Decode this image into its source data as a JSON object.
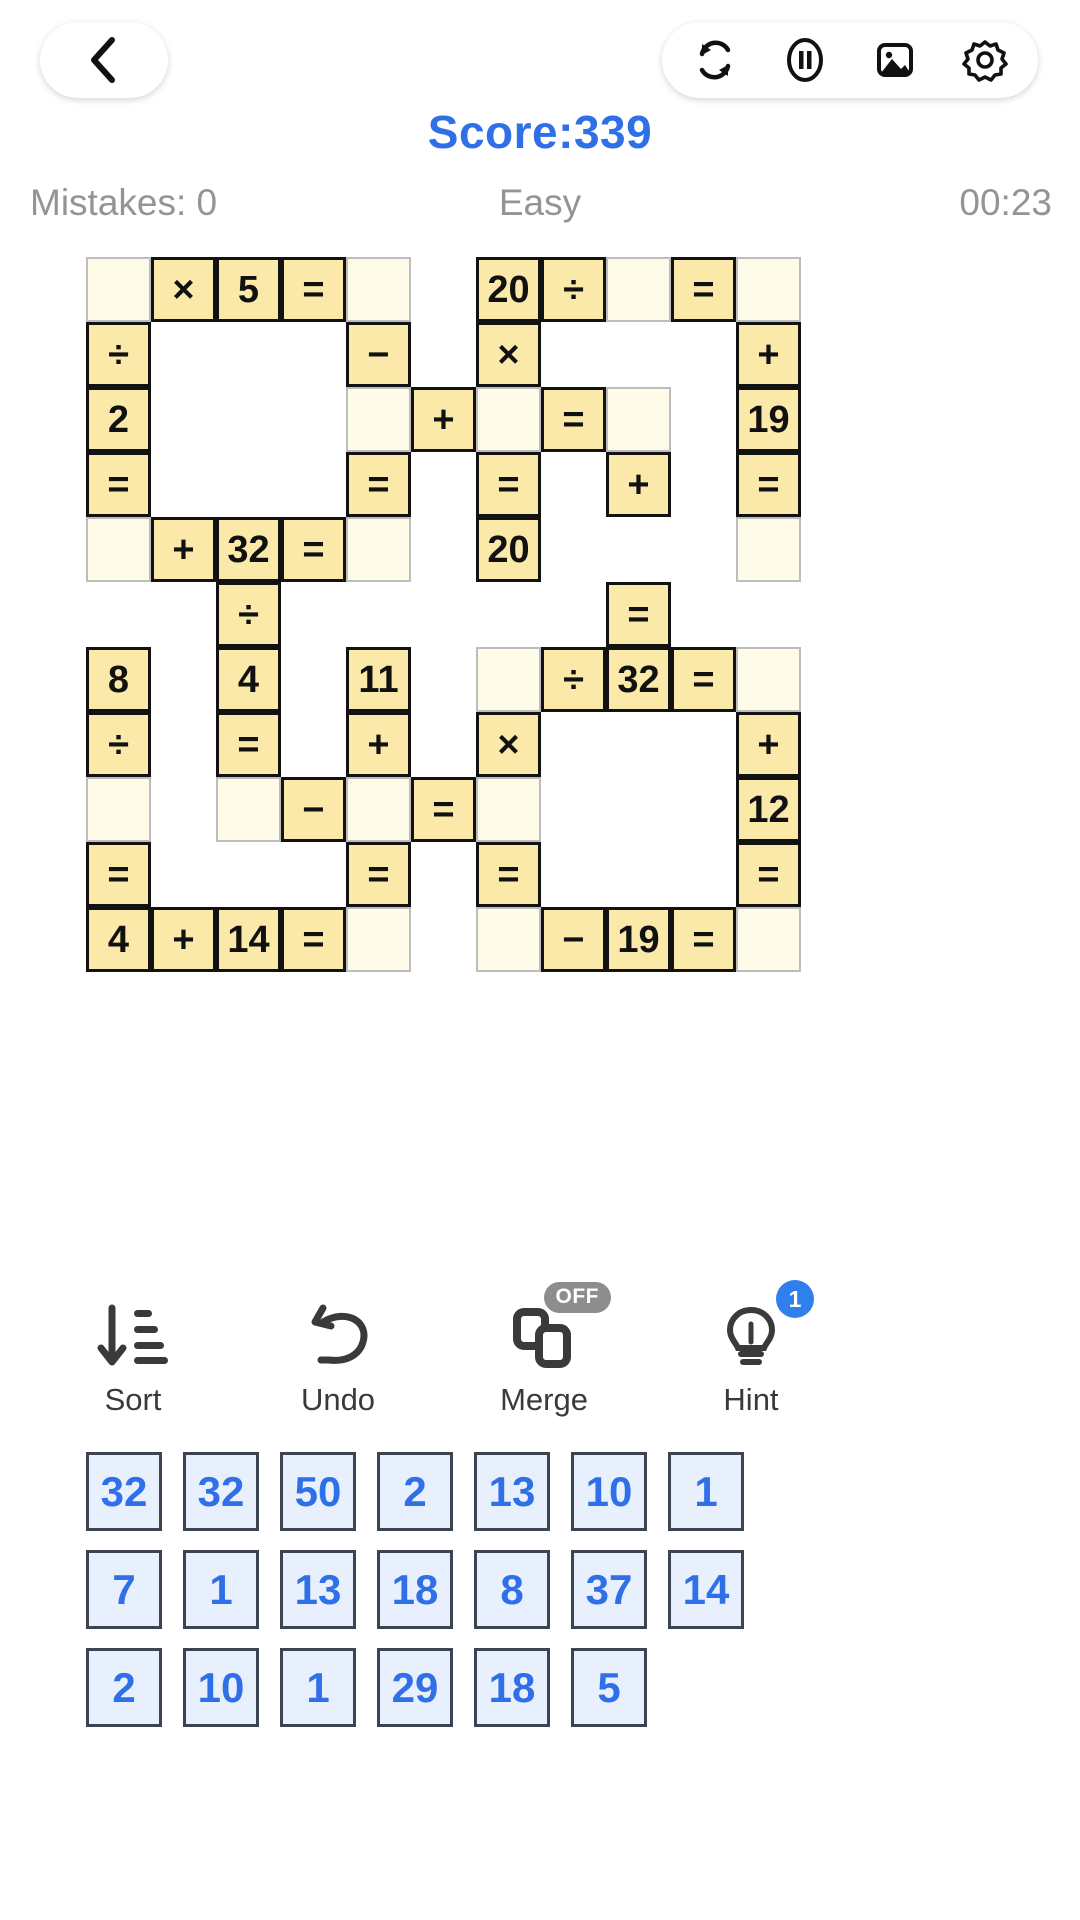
{
  "header": {
    "back_icon": "chevron-left-icon",
    "tools": [
      {
        "name": "restart-icon",
        "label": "Restart"
      },
      {
        "name": "pause-icon",
        "label": "Pause"
      },
      {
        "name": "image-icon",
        "label": "Theme"
      },
      {
        "name": "gear-icon",
        "label": "Settings"
      }
    ]
  },
  "status": {
    "score": "Score:339",
    "mistakes": "Mistakes: 0",
    "difficulty": "Easy",
    "time": "00:23"
  },
  "colors": {
    "score_blue": "#2f6fe8",
    "tile_blue": "#2f6fe8",
    "cell_fill": "#fae9a8",
    "cell_slot": "#fefbe9",
    "badge_grey": "#8d8d8d",
    "badge_blue": "#2f80ed"
  },
  "grid": {
    "cols": 11,
    "rows": 11,
    "cells": [
      {
        "r": 0,
        "c": 0,
        "type": "slot",
        "text": ""
      },
      {
        "r": 0,
        "c": 1,
        "type": "filled",
        "text": "×"
      },
      {
        "r": 0,
        "c": 2,
        "type": "filled",
        "text": "5"
      },
      {
        "r": 0,
        "c": 3,
        "type": "filled",
        "text": "="
      },
      {
        "r": 0,
        "c": 4,
        "type": "slot",
        "text": ""
      },
      {
        "r": 0,
        "c": 6,
        "type": "filled",
        "text": "20"
      },
      {
        "r": 0,
        "c": 7,
        "type": "filled",
        "text": "÷"
      },
      {
        "r": 0,
        "c": 8,
        "type": "slot",
        "text": ""
      },
      {
        "r": 0,
        "c": 9,
        "type": "filled",
        "text": "="
      },
      {
        "r": 0,
        "c": 10,
        "type": "slot",
        "text": ""
      },
      {
        "r": 1,
        "c": 0,
        "type": "filled",
        "text": "÷"
      },
      {
        "r": 1,
        "c": 4,
        "type": "filled",
        "text": "−"
      },
      {
        "r": 1,
        "c": 6,
        "type": "filled",
        "text": "×"
      },
      {
        "r": 1,
        "c": 10,
        "type": "filled",
        "text": "+"
      },
      {
        "r": 2,
        "c": 0,
        "type": "filled",
        "text": "2"
      },
      {
        "r": 2,
        "c": 4,
        "type": "slot",
        "text": ""
      },
      {
        "r": 2,
        "c": 5,
        "type": "filled",
        "text": "+"
      },
      {
        "r": 2,
        "c": 6,
        "type": "slot",
        "text": ""
      },
      {
        "r": 2,
        "c": 7,
        "type": "filled",
        "text": "="
      },
      {
        "r": 2,
        "c": 8,
        "type": "slot",
        "text": ""
      },
      {
        "r": 2,
        "c": 10,
        "type": "filled",
        "text": "19"
      },
      {
        "r": 3,
        "c": 0,
        "type": "filled",
        "text": "="
      },
      {
        "r": 3,
        "c": 4,
        "type": "filled",
        "text": "="
      },
      {
        "r": 3,
        "c": 6,
        "type": "filled",
        "text": "="
      },
      {
        "r": 3,
        "c": 8,
        "type": "filled",
        "text": "+"
      },
      {
        "r": 3,
        "c": 10,
        "type": "filled",
        "text": "="
      },
      {
        "r": 4,
        "c": 0,
        "type": "slot",
        "text": ""
      },
      {
        "r": 4,
        "c": 1,
        "type": "filled",
        "text": "+"
      },
      {
        "r": 4,
        "c": 2,
        "type": "filled",
        "text": "32"
      },
      {
        "r": 4,
        "c": 3,
        "type": "filled",
        "text": "="
      },
      {
        "r": 4,
        "c": 4,
        "type": "slot",
        "text": ""
      },
      {
        "r": 4,
        "c": 6,
        "type": "filled",
        "text": "20"
      },
      {
        "r": 4,
        "c": 10,
        "type": "slot",
        "text": ""
      },
      {
        "r": 5,
        "c": 2,
        "type": "filled",
        "text": "÷"
      },
      {
        "r": 5,
        "c": 8,
        "type": "filled",
        "text": "="
      },
      {
        "r": 6,
        "c": 0,
        "type": "filled",
        "text": "8"
      },
      {
        "r": 6,
        "c": 2,
        "type": "filled",
        "text": "4"
      },
      {
        "r": 6,
        "c": 4,
        "type": "filled",
        "text": "11"
      },
      {
        "r": 6,
        "c": 6,
        "type": "slot",
        "text": ""
      },
      {
        "r": 6,
        "c": 7,
        "type": "filled",
        "text": "÷"
      },
      {
        "r": 6,
        "c": 8,
        "type": "filled",
        "text": "32"
      },
      {
        "r": 6,
        "c": 9,
        "type": "filled",
        "text": "="
      },
      {
        "r": 6,
        "c": 10,
        "type": "slot",
        "text": ""
      },
      {
        "r": 7,
        "c": 0,
        "type": "filled",
        "text": "÷"
      },
      {
        "r": 7,
        "c": 2,
        "type": "filled",
        "text": "="
      },
      {
        "r": 7,
        "c": 4,
        "type": "filled",
        "text": "+"
      },
      {
        "r": 7,
        "c": 6,
        "type": "filled",
        "text": "×"
      },
      {
        "r": 7,
        "c": 10,
        "type": "filled",
        "text": "+"
      },
      {
        "r": 8,
        "c": 0,
        "type": "slot",
        "text": ""
      },
      {
        "r": 8,
        "c": 2,
        "type": "slot",
        "text": ""
      },
      {
        "r": 8,
        "c": 3,
        "type": "filled",
        "text": "−"
      },
      {
        "r": 8,
        "c": 4,
        "type": "slot",
        "text": ""
      },
      {
        "r": 8,
        "c": 5,
        "type": "filled",
        "text": "="
      },
      {
        "r": 8,
        "c": 6,
        "type": "slot",
        "text": ""
      },
      {
        "r": 8,
        "c": 10,
        "type": "filled",
        "text": "12"
      },
      {
        "r": 9,
        "c": 0,
        "type": "filled",
        "text": "="
      },
      {
        "r": 9,
        "c": 4,
        "type": "filled",
        "text": "="
      },
      {
        "r": 9,
        "c": 6,
        "type": "filled",
        "text": "="
      },
      {
        "r": 9,
        "c": 10,
        "type": "filled",
        "text": "="
      },
      {
        "r": 10,
        "c": 0,
        "type": "filled",
        "text": "4"
      },
      {
        "r": 10,
        "c": 1,
        "type": "filled",
        "text": "+"
      },
      {
        "r": 10,
        "c": 2,
        "type": "filled",
        "text": "14"
      },
      {
        "r": 10,
        "c": 3,
        "type": "filled",
        "text": "="
      },
      {
        "r": 10,
        "c": 4,
        "type": "slot",
        "text": ""
      },
      {
        "r": 10,
        "c": 6,
        "type": "slot",
        "text": ""
      },
      {
        "r": 10,
        "c": 7,
        "type": "filled",
        "text": "−"
      },
      {
        "r": 10,
        "c": 8,
        "type": "filled",
        "text": "19"
      },
      {
        "r": 10,
        "c": 9,
        "type": "filled",
        "text": "="
      },
      {
        "r": 10,
        "c": 10,
        "type": "slot",
        "text": ""
      }
    ]
  },
  "actions": [
    {
      "key": "sort",
      "label": "Sort",
      "icon": "sort-descending-icon",
      "badge": null
    },
    {
      "key": "undo",
      "label": "Undo",
      "icon": "undo-arrow-icon",
      "badge": null
    },
    {
      "key": "merge",
      "label": "Merge",
      "icon": "merge-cards-icon",
      "badge": "OFF"
    },
    {
      "key": "hint",
      "label": "Hint",
      "icon": "lightbulb-icon",
      "badge": "1"
    }
  ],
  "tray": {
    "rows": [
      [
        "32",
        "32",
        "50",
        "2",
        "13",
        "10",
        "1"
      ],
      [
        "7",
        "1",
        "13",
        "18",
        "8",
        "37",
        "14"
      ],
      [
        "2",
        "10",
        "1",
        "29",
        "18",
        "5"
      ]
    ]
  }
}
